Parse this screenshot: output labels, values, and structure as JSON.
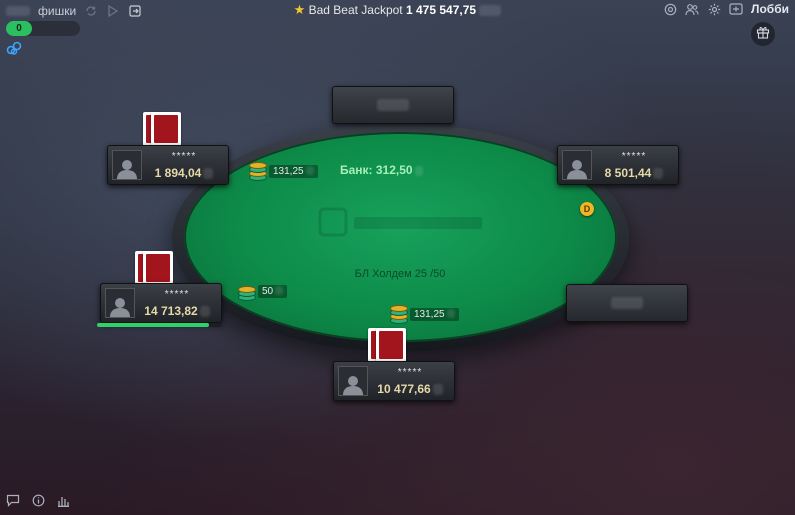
{
  "topbar": {
    "chips_label": "фишки",
    "jackpot_label": "Bad Beat Jackpot",
    "jackpot_amount": "1 475 547,75",
    "lobby_label": "Лобби",
    "icons": [
      "refresh-icon",
      "play-icon",
      "exit-icon",
      "settings-icon",
      "users-icon",
      "gear-icon",
      "rebuy-icon"
    ]
  },
  "counter": {
    "value": "0"
  },
  "table": {
    "pot_label": "Банк: 312,50",
    "game_name": "БЛ Холдем 25 /50",
    "dealer_button": "D"
  },
  "seats": [
    {
      "name": "*****",
      "stack": "1 894,04"
    },
    {
      "name": "*****",
      "stack": "8 501,44"
    },
    {
      "name": "*****",
      "stack": "14 713,82"
    },
    {
      "name": "*****",
      "stack": "10 477,66"
    }
  ],
  "bets": [
    {
      "amount": "131,25"
    },
    {
      "amount": "50"
    },
    {
      "amount": "131,25"
    }
  ],
  "timer": {
    "fraction": 0.9
  },
  "colors": {
    "felt": "#0d8a48",
    "accent_green": "#2bbf62",
    "card_back": "#a3151c",
    "dealer": "#f0b626"
  }
}
